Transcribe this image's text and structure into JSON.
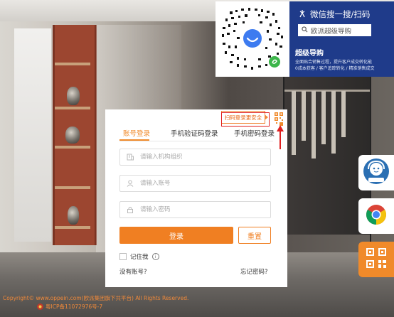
{
  "wechat": {
    "title": "微信搜一搜/扫码",
    "search_placeholder": "欧派超级导购",
    "name": "超级导购",
    "desc_line1": "全面贴合销售过程，提升客户成交转化能",
    "desc_line2": "0成本获客 / 客户追踪转化 / 精准销售成交"
  },
  "login": {
    "qr_hint": "扫码登录更安全",
    "tabs": [
      "账号登录",
      "手机验证码登录",
      "手机密码登录"
    ],
    "active_tab": 0,
    "org_placeholder": "请输入机构组织",
    "account_placeholder": "请输入账号",
    "password_placeholder": "请输入密码",
    "login_label": "登录",
    "reset_label": "重置",
    "remember_label": "记住我",
    "no_account": "没有账号?",
    "forgot": "忘记密码?"
  },
  "footer": {
    "copyright": "Copyright© www.oppein.com(欧派集团旗下共平台) All Rights Reserved.",
    "icp": "粤ICP备11072976号-7"
  },
  "colors": {
    "accent": "#f07f22",
    "brand_blue": "#1f3b8a",
    "callout": "#e02020"
  },
  "icons": {
    "org": "building-icon",
    "account": "user-icon",
    "password": "lock-icon",
    "service": "customer-service-icon",
    "browser": "chrome-icon",
    "qr": "qr-code-icon"
  }
}
